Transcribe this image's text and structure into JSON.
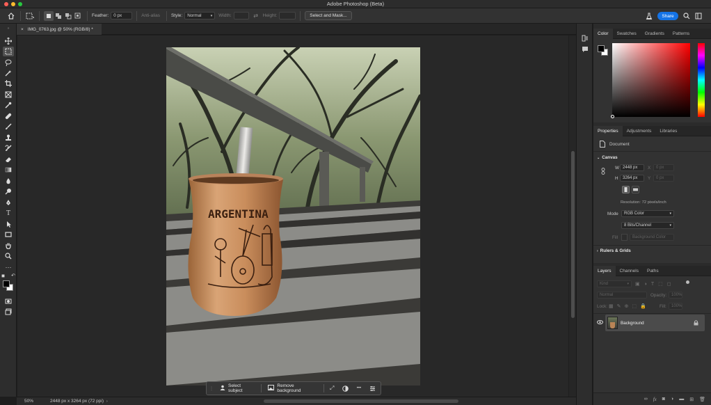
{
  "app": {
    "title": "Adobe Photoshop (Beta)",
    "share_label": "Share"
  },
  "options_bar": {
    "feather_label": "Feather:",
    "feather_value": "0 px",
    "anti_alias_label": "Anti-alias",
    "style_label": "Style:",
    "style_value": "Normal",
    "width_label": "Width:",
    "height_label": "Height:",
    "select_mask_label": "Select and Mask..."
  },
  "document": {
    "tab_label": "IMG_0763.jpg @ 50% (RGB/8) *",
    "close_glyph": "×"
  },
  "status_bar": {
    "zoom": "50%",
    "doc_info": "2448 px x 3264 px (72 ppi)"
  },
  "taskbar": {
    "select_subject": "Select subject",
    "remove_background": "Remove background",
    "more": "•••"
  },
  "photo": {
    "cup_text": "ARGENTINA"
  },
  "color_panel": {
    "tabs": [
      "Color",
      "Swatches",
      "Gradients",
      "Patterns"
    ],
    "accent": "#ff0000"
  },
  "properties_panel": {
    "tabs": [
      "Properties",
      "Adjustments",
      "Libraries"
    ],
    "document_label": "Document",
    "canvas_section": "Canvas",
    "w_label": "W",
    "w_value": "2448 px",
    "h_label": "H",
    "h_value": "3264 px",
    "x_label": "X",
    "x_value": "0 px",
    "y_label": "Y",
    "y_value": "0 px",
    "resolution": "Resolution: 72 pixels/inch",
    "mode_label": "Mode",
    "mode_value": "RGB Color",
    "bits_value": "8 Bits/Channel",
    "fill_label": "Fill",
    "fill_value": "Background Color",
    "rulers_section": "Rulers & Grids"
  },
  "layers_panel": {
    "tabs": [
      "Layers",
      "Channels",
      "Paths"
    ],
    "kind_label": "Kind",
    "blend_mode": "Normal",
    "opacity_label": "Opacity:",
    "opacity_value": "100%",
    "lock_label": "Lock:",
    "fill_label": "Fill:",
    "fill_value": "100%",
    "layer_name": "Background"
  },
  "colors": {
    "share_blue": "#1473e6",
    "panel_bg": "#323232",
    "canvas_bg": "#282828"
  }
}
